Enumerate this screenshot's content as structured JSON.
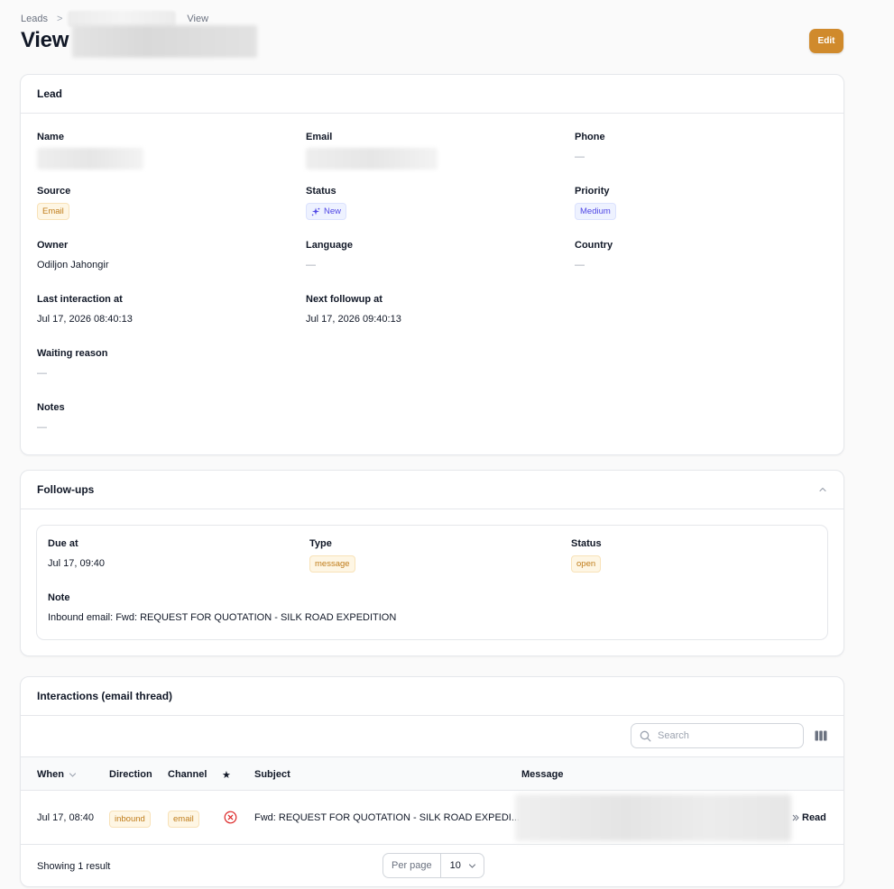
{
  "breadcrumb": {
    "root": "Leads",
    "sep": ">",
    "current": "View"
  },
  "header": {
    "title": "View",
    "edit_label": "Edit"
  },
  "lead": {
    "title": "Lead",
    "name_label": "Name",
    "email_label": "Email",
    "phone_label": "Phone",
    "phone_value": "—",
    "source_label": "Source",
    "source_value": "Email",
    "status_label": "Status",
    "status_value": "New",
    "priority_label": "Priority",
    "priority_value": "Medium",
    "owner_label": "Owner",
    "owner_value": "Odiljon Jahongir",
    "language_label": "Language",
    "language_value": "—",
    "country_label": "Country",
    "country_value": "—",
    "last_interaction_label": "Last interaction at",
    "last_interaction_value": "Jul 17, 2026 08:40:13",
    "next_followup_label": "Next followup at",
    "next_followup_value": "Jul 17, 2026 09:40:13",
    "waiting_reason_label": "Waiting reason",
    "waiting_reason_value": "—",
    "notes_label": "Notes",
    "notes_value": "—"
  },
  "followups": {
    "title": "Follow-ups",
    "due_label": "Due at",
    "due_value": "Jul 17, 09:40",
    "type_label": "Type",
    "type_value": "message",
    "status_label": "Status",
    "status_value": "open",
    "note_label": "Note",
    "note_value": "Inbound email: Fwd: REQUEST FOR QUOTATION - SILK ROAD EXPEDITION"
  },
  "interactions": {
    "title": "Interactions (email thread)",
    "search_placeholder": "Search",
    "columns": {
      "when": "When",
      "direction": "Direction",
      "channel": "Channel",
      "star": "★",
      "subject": "Subject",
      "message": "Message"
    },
    "rows": [
      {
        "when": "Jul 17, 08:40",
        "direction": "inbound",
        "channel": "email",
        "subject": "Fwd: REQUEST FOR QUOTATION - SILK ROAD EXPEDI...",
        "action": "Read"
      }
    ],
    "footer": {
      "showing": "Showing 1 result",
      "per_page_label": "Per page",
      "per_page_value": "10"
    }
  },
  "colors": {
    "accent": "#d08a2c",
    "badge_amber_text": "#c07d1b",
    "badge_blue_text": "#4f46e5",
    "error_red": "#dc2626"
  }
}
